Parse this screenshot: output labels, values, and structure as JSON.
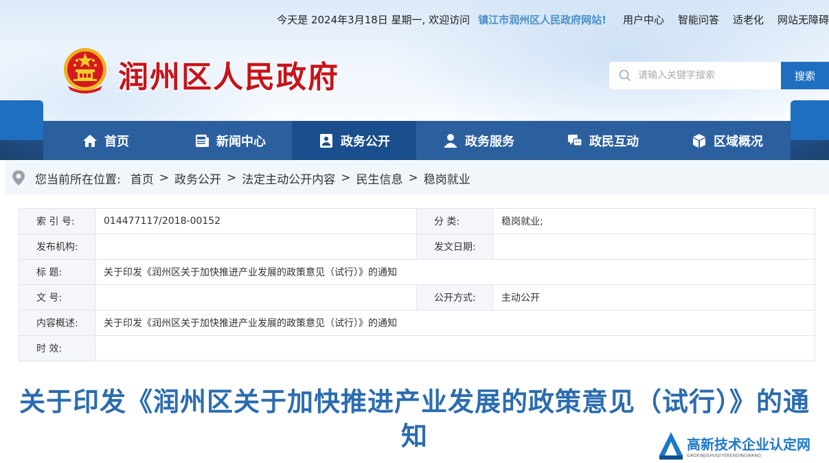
{
  "topbar": {
    "date_text": "今天是 2024年3月18日 星期一, 欢迎访问",
    "site_link": "镇江市润州区人民政府网站!",
    "links": [
      "用户中心",
      "智能问答",
      "适老化",
      "网站无障碍"
    ]
  },
  "header": {
    "title": "润州区人民政府"
  },
  "search": {
    "placeholder": "请输入关键字搜索",
    "button": "搜索"
  },
  "nav": {
    "items": [
      {
        "label": "首页",
        "icon": "home-icon"
      },
      {
        "label": "新闻中心",
        "icon": "news-icon"
      },
      {
        "label": "政务公开",
        "icon": "government-affairs-icon"
      },
      {
        "label": "政务服务",
        "icon": "user-service-icon"
      },
      {
        "label": "政民互动",
        "icon": "chat-icon"
      },
      {
        "label": "区域概况",
        "icon": "cube-icon"
      }
    ],
    "active_index": 2
  },
  "breadcrumb": {
    "prefix": "您当前所在位置:",
    "items": [
      "首页",
      "政务公开",
      "法定主动公开内容",
      "民生信息",
      "稳岗就业"
    ],
    "separator": ">"
  },
  "meta": {
    "index_label": "索 引 号:",
    "index_value": "014477117/2018-00152",
    "category_label": "分    类:",
    "category_value": "稳岗就业;",
    "publisher_label": "发布机构:",
    "publisher_value": "",
    "date_label": "发文日期:",
    "date_value": "",
    "title_label": "标    题:",
    "title_value": "关于印发《润州区关于加快推进产业发展的政策意见（试行）》的通知",
    "docno_label": "文    号:",
    "docno_value": "",
    "disclosure_label": "公开方式:",
    "disclosure_value": "主动公开",
    "summary_label": "内容概述:",
    "summary_value": "关于印发《润州区关于加快推进产业发展的政策意见（试行）》的通知",
    "validity_label": "时    效:",
    "validity_value": ""
  },
  "article": {
    "title": "关于印发《润州区关于加快推进产业发展的政策意见（试行）》的通知"
  },
  "watermark": {
    "main": "高新技术企业认定网",
    "sub": "GAOXINJISHUQIYERENDINGWANG"
  },
  "colors": {
    "title_red": "#c6141b",
    "nav_blue": "#2c5f9e",
    "nav_active": "#1a4e8c",
    "accent_blue": "#1f6fc0",
    "article_title": "#2b6cb0"
  }
}
